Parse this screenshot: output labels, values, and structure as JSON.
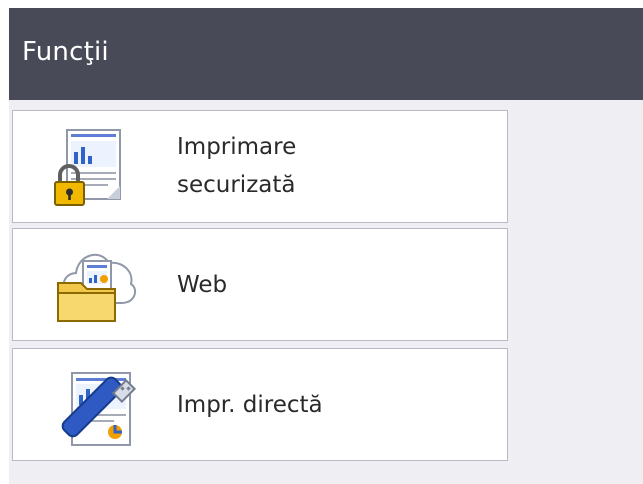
{
  "screen": {
    "title": "Funcţii"
  },
  "menu": {
    "items": [
      {
        "id": "secure-print",
        "label_lines": [
          "Imprimare",
          "securizată"
        ],
        "icon": "secure-print-icon"
      },
      {
        "id": "web",
        "label": "Web",
        "icon": "web-folder-icon"
      },
      {
        "id": "direct-print",
        "label": "Impr. directă",
        "icon": "usb-direct-print-icon"
      }
    ]
  },
  "colors": {
    "titlebar": "#484a58",
    "title_text": "#ffffff",
    "content_bg": "#eeeef3",
    "item_bg": "#ffffff",
    "item_border": "#b8bac6",
    "label_text": "#2a2a2a",
    "accent_blue": "#2f63c8",
    "folder_yellow": "#f2c84b",
    "lock_gold": "#f0b800"
  }
}
